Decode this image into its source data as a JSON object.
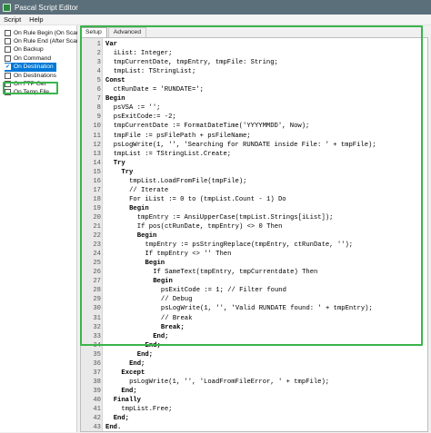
{
  "window": {
    "title": "Pascal Script Editor"
  },
  "menu": [
    {
      "label": "Script"
    },
    {
      "label": "Help"
    }
  ],
  "sidebar": {
    "items": [
      {
        "label": "On Rule Begin (On Scan)",
        "checked": false,
        "selected": false
      },
      {
        "label": "On Rule End (After Scan)",
        "checked": false,
        "selected": false
      },
      {
        "label": "On Backup",
        "checked": false,
        "selected": false
      },
      {
        "label": "On Command",
        "checked": false,
        "selected": false
      },
      {
        "label": "On Destination",
        "checked": true,
        "selected": true
      },
      {
        "label": "On Destinations",
        "checked": false,
        "selected": false
      },
      {
        "label": "On FTP Get",
        "checked": false,
        "selected": false
      },
      {
        "label": "On Temp File",
        "checked": false,
        "selected": false
      }
    ]
  },
  "tabs": [
    {
      "label": "Setup",
      "active": true
    },
    {
      "label": "Advanced",
      "active": false
    }
  ],
  "editor": {
    "lines": [
      {
        "n": "1",
        "indent": 0,
        "text": "Var",
        "kw": true
      },
      {
        "n": "2",
        "indent": 2,
        "text": "iList: Integer;",
        "kw": false
      },
      {
        "n": "3",
        "indent": 2,
        "text": "tmpCurrentDate, tmpEntry, tmpFile: String;",
        "kw": false
      },
      {
        "n": "4",
        "indent": 2,
        "text": "tmpList: TStringList;",
        "kw": false
      },
      {
        "n": "5",
        "indent": 0,
        "text": "Const",
        "kw": true
      },
      {
        "n": "6",
        "indent": 2,
        "text": "ctRunDate = 'RUNDATE=';",
        "kw": false
      },
      {
        "n": "7",
        "indent": 0,
        "text": "Begin",
        "kw": true
      },
      {
        "n": "8",
        "indent": 2,
        "text": "psVSA := '';",
        "kw": false
      },
      {
        "n": "9",
        "indent": 2,
        "text": "psExitCode:= -2;",
        "kw": false
      },
      {
        "n": "10",
        "indent": 2,
        "text": "tmpCurrentDate := FormatDateTime('YYYYMMDD', Now);",
        "kw": false
      },
      {
        "n": "11",
        "indent": 2,
        "text": "tmpFile := psFilePath + psFileName;",
        "kw": false
      },
      {
        "n": "12",
        "indent": 2,
        "text": "psLogWrite(1, '', 'Searching for RUNDATE inside File: ' + tmpFile);",
        "kw": false
      },
      {
        "n": "13",
        "indent": 2,
        "text": "tmpList := TStringList.Create;",
        "kw": false
      },
      {
        "n": "14",
        "indent": 2,
        "text": "Try",
        "kw": true
      },
      {
        "n": "15",
        "indent": 4,
        "text": "Try",
        "kw": true
      },
      {
        "n": "16",
        "indent": 6,
        "text": "tmpList.LoadFromFile(tmpFile);",
        "kw": false
      },
      {
        "n": "17",
        "indent": 6,
        "text": "// Iterate",
        "kw": false
      },
      {
        "n": "18",
        "indent": 6,
        "text": "For iList := 0 to (tmpList.Count - 1) Do",
        "kw": false
      },
      {
        "n": "19",
        "indent": 6,
        "text": "Begin",
        "kw": true
      },
      {
        "n": "20",
        "indent": 8,
        "text": "tmpEntry := AnsiUpperCase(tmpList.Strings[iList]);",
        "kw": false
      },
      {
        "n": "21",
        "indent": 8,
        "text": "If pos(ctRunDate, tmpEntry) <> 0 Then",
        "kw": false
      },
      {
        "n": "22",
        "indent": 8,
        "text": "Begin",
        "kw": true
      },
      {
        "n": "23",
        "indent": 10,
        "text": "tmpEntry := psStringReplace(tmpEntry, ctRunDate, '');",
        "kw": false
      },
      {
        "n": "24",
        "indent": 10,
        "text": "If tmpEntry <> '' Then",
        "kw": false
      },
      {
        "n": "25",
        "indent": 10,
        "text": "Begin",
        "kw": true
      },
      {
        "n": "26",
        "indent": 12,
        "text": "If SameText(tmpEntry, tmpCurrentdate) Then",
        "kw": false
      },
      {
        "n": "27",
        "indent": 12,
        "text": "Begin",
        "kw": true
      },
      {
        "n": "28",
        "indent": 14,
        "text": "psExitCode := 1; // Filter found",
        "kw": false
      },
      {
        "n": "29",
        "indent": 14,
        "text": "// Debug",
        "kw": false
      },
      {
        "n": "30",
        "indent": 14,
        "text": "psLogWrite(1, '', 'Valid RUNDATE found: ' + tmpEntry);",
        "kw": false
      },
      {
        "n": "31",
        "indent": 14,
        "text": "// Break",
        "kw": false
      },
      {
        "n": "32",
        "indent": 14,
        "text": "Break;",
        "kw": true
      },
      {
        "n": "33",
        "indent": 12,
        "text": "End;",
        "kw": true
      },
      {
        "n": "34",
        "indent": 10,
        "text": "End;",
        "kw": true
      },
      {
        "n": "35",
        "indent": 8,
        "text": "End;",
        "kw": true
      },
      {
        "n": "36",
        "indent": 6,
        "text": "End;",
        "kw": true
      },
      {
        "n": "37",
        "indent": 4,
        "text": "Except",
        "kw": true
      },
      {
        "n": "38",
        "indent": 6,
        "text": "psLogWrite(1, '', 'LoadFromFileError, ' + tmpFile);",
        "kw": false
      },
      {
        "n": "39",
        "indent": 4,
        "text": "End;",
        "kw": true
      },
      {
        "n": "40",
        "indent": 2,
        "text": "Finally",
        "kw": true
      },
      {
        "n": "41",
        "indent": 4,
        "text": "tmpList.Free;",
        "kw": false
      },
      {
        "n": "42",
        "indent": 2,
        "text": "End;",
        "kw": true
      },
      {
        "n": "43",
        "indent": 0,
        "text": "End.",
        "kw": true
      }
    ]
  }
}
